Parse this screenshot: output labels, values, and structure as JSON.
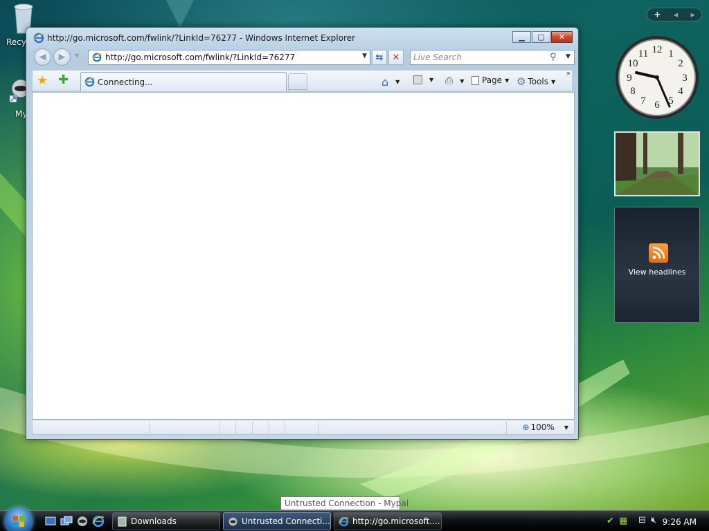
{
  "desktop": {
    "icons": [
      {
        "label": "Recyc",
        "icon": "recycle-bin-icon"
      },
      {
        "label": "My",
        "icon": "my-shortcut-icon"
      }
    ]
  },
  "ie_window": {
    "title": "http://go.microsoft.com/fwlink/?LinkId=76277 - Windows Internet Explorer",
    "address": "http://go.microsoft.com/fwlink/?LinkId=76277",
    "search_placeholder": "Live Search",
    "tab_label": "Connecting...",
    "commands": {
      "page": "Page",
      "tools": "Tools"
    },
    "zoom": "100%"
  },
  "sidebar": {
    "controls": {
      "add": "+",
      "prev": "◂",
      "next": "▸"
    },
    "clock": {
      "numerals": [
        "12",
        "1",
        "2",
        "3",
        "4",
        "5",
        "6",
        "7",
        "8",
        "9",
        "10",
        "11"
      ]
    },
    "feed_label": "View headlines"
  },
  "tooltip": "Untrusted Connection - Mypal",
  "taskbar": {
    "buttons": [
      {
        "label": "Downloads",
        "icon": "folder-icon"
      },
      {
        "label": "Untrusted Connecti...",
        "icon": "mypal-icon"
      },
      {
        "label": "http://go.microsoft....",
        "icon": "ie-icon"
      }
    ],
    "time": "9:26 AM"
  },
  "colors": {
    "accent": "#2e6fb0",
    "close_button": "#c94a2e",
    "rss": "#e06d10"
  }
}
